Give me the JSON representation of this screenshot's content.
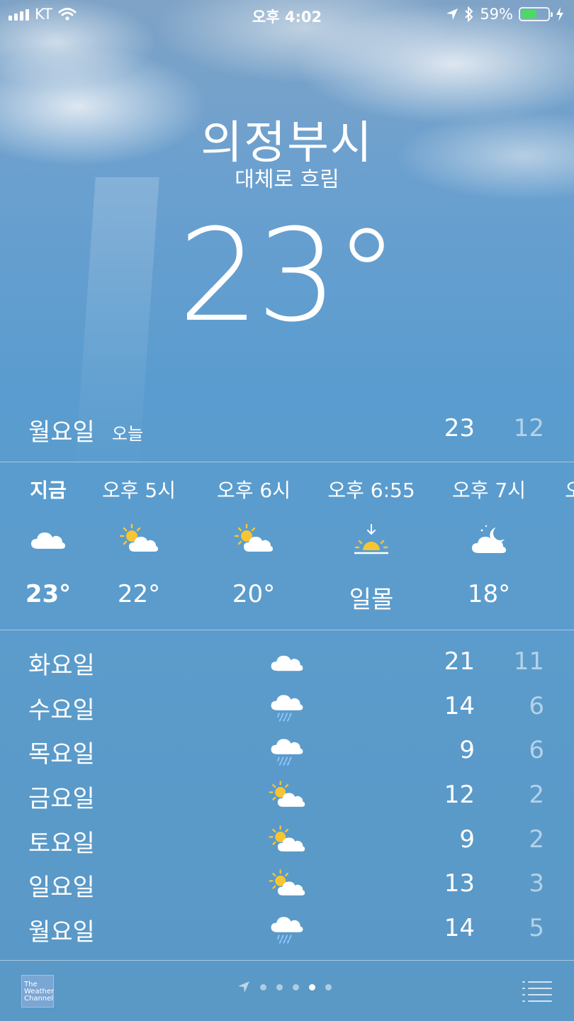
{
  "status_bar": {
    "carrier": "KT",
    "time": "오후 4:02",
    "battery": "59%",
    "battery_level": 0.59,
    "battery_color": "#4cd964"
  },
  "location": {
    "city": "의정부시",
    "condition": "대체로 흐림",
    "temperature": "23°"
  },
  "today": {
    "day": "월요일",
    "tag": "오늘",
    "high": "23",
    "low": "12"
  },
  "hourly": [
    {
      "time": "지금",
      "icon": "cloud-icon",
      "value": "23°",
      "now": true
    },
    {
      "time": "오후 5시",
      "icon": "partly-sunny-icon",
      "value": "22°"
    },
    {
      "time": "오후 6시",
      "icon": "partly-sunny-icon",
      "value": "20°"
    },
    {
      "time": "오후 6:55",
      "icon": "sunset-icon",
      "value": "일몰"
    },
    {
      "time": "오후 7시",
      "icon": "partly-cloudy-night-icon",
      "value": "18°"
    },
    {
      "time": "오",
      "icon": "",
      "value": ""
    }
  ],
  "daily": [
    {
      "day": "화요일",
      "icon": "cloud-icon",
      "high": "21",
      "low": "11"
    },
    {
      "day": "수요일",
      "icon": "rain-icon",
      "high": "14",
      "low": "6"
    },
    {
      "day": "목요일",
      "icon": "rain-icon",
      "high": "9",
      "low": "6"
    },
    {
      "day": "금요일",
      "icon": "partly-sunny-icon",
      "high": "12",
      "low": "2"
    },
    {
      "day": "토요일",
      "icon": "partly-sunny-icon",
      "high": "9",
      "low": "2"
    },
    {
      "day": "일요일",
      "icon": "partly-sunny-icon",
      "high": "13",
      "low": "3"
    },
    {
      "day": "월요일",
      "icon": "rain-icon",
      "high": "14",
      "low": "5"
    }
  ],
  "footer": {
    "provider_logo_text": "The Weather Channel",
    "pages": 5,
    "active_page": 4
  }
}
